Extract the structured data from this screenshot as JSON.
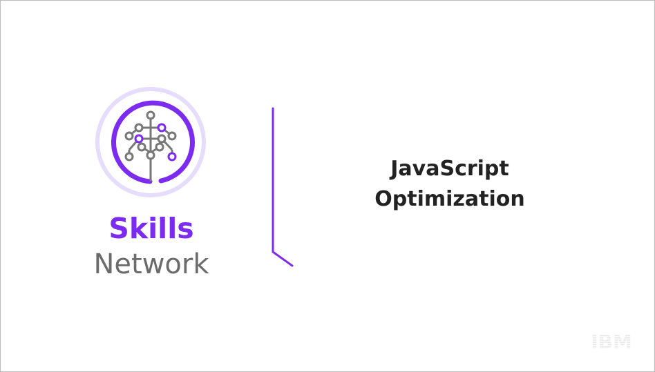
{
  "brand": {
    "name_line1": "Skills",
    "name_line2": "Network",
    "accent_color": "#7b2cf0",
    "secondary_color": "#6b6b6b"
  },
  "title": {
    "line1": "JavaScript",
    "line2": "Optimization"
  },
  "corporate_logo": {
    "text": "IBM",
    "icon": "ibm-logo"
  },
  "icons": [
    "skills-network-tree-icon",
    "divider-line",
    "ibm-logo"
  ]
}
